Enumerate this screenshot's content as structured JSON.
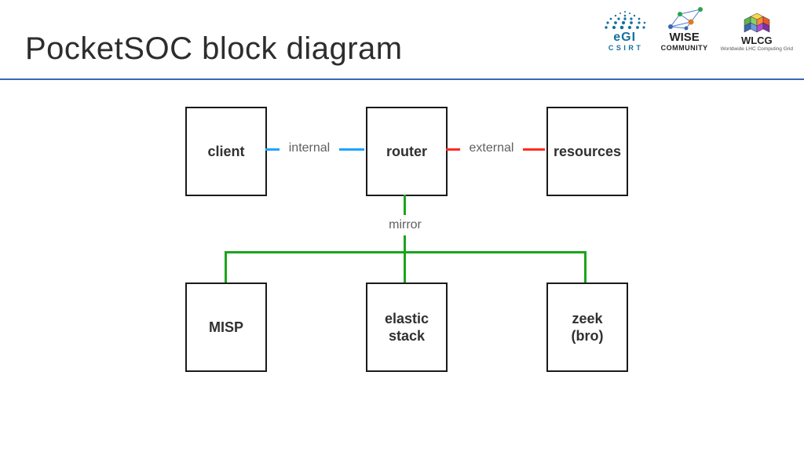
{
  "title": "PocketSOC block diagram",
  "logos": {
    "egi": {
      "word": "eGI",
      "sub": "C S I R T"
    },
    "wise": {
      "word": "WISE",
      "sub": "COMMUNITY"
    },
    "wlcg": {
      "word": "WLCG",
      "sub": "Worldwide LHC Computing Grid"
    }
  },
  "nodes": {
    "client": "client",
    "router": "router",
    "resources": "resources",
    "misp": "MISP",
    "elastic": "elastic\nstack",
    "zeek": "zeek\n(bro)"
  },
  "edges": {
    "internal": "internal",
    "external": "external",
    "mirror": "mirror"
  },
  "colors": {
    "internal": "#1fa3ff",
    "external": "#ff2b1f",
    "mirror": "#1aa51a",
    "rule": "#3b66b3"
  }
}
